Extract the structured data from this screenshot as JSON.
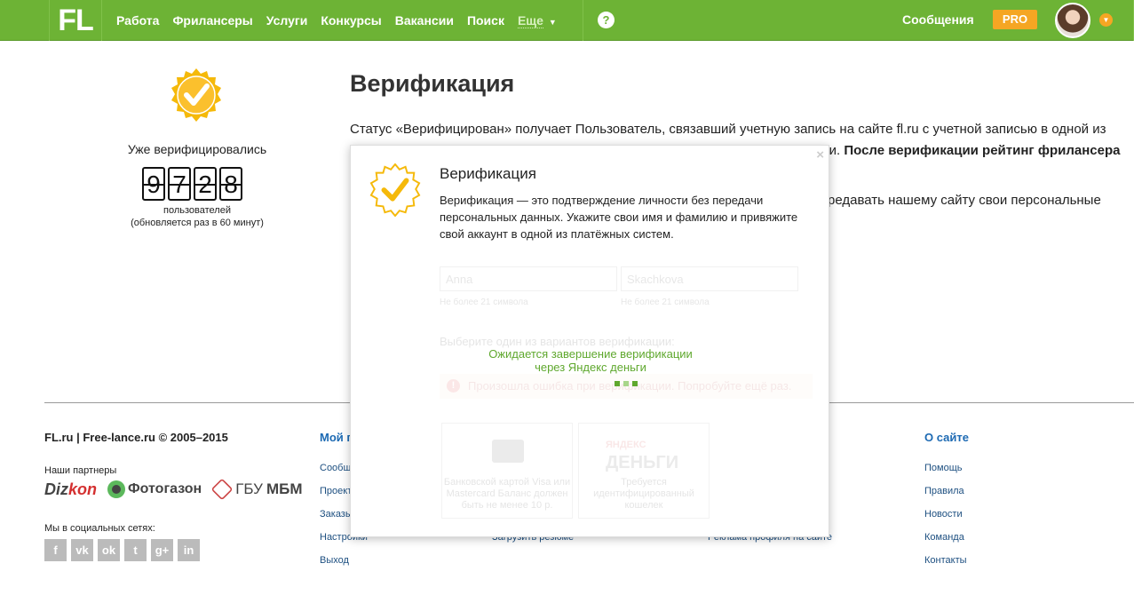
{
  "header": {
    "logo": "FL",
    "nav": [
      "Работа",
      "Фрилансеры",
      "Услуги",
      "Конкурсы",
      "Вакансии",
      "Поиск"
    ],
    "more": "Еще",
    "help": "?",
    "messages": "Сообщения",
    "pro": "PRO"
  },
  "left": {
    "already": "Уже верифицировались",
    "digits": [
      "9",
      "7",
      "2",
      "8"
    ],
    "users": "пользователей",
    "updated": "(обновляется раз в 60 минут)"
  },
  "main": {
    "title": "Верификация",
    "para1_start": "Статус «Верифицирован» получает Пользователь, связавший учетную запись на сайте fl.ru с учетной записью в одной из платежных систем, где хранится подтвержденная информация о его личности. ",
    "para1_bold": "После верификации рейтинг фрилансера",
    "para2": "редавать нашему сайту свои персональные"
  },
  "modal": {
    "close": "×",
    "title": "Верификация",
    "desc": "Верификация — это подтверждение личности без передачи персональных данных. Укажите свои имя и фамилию и привяжите свой аккаунт в одной из платёжных систем.",
    "first_name": "Anna",
    "last_name": "Skachkova",
    "hint": "Не более 21 символа",
    "choose": "Выберите один из вариантов верификации:",
    "error": "Произошла ошибка при верификации. Попробуйте ещё раз.",
    "card_text": "Банковской картой Visa или Mastercard Баланс должен быть не менее 10 р.",
    "yd_logo_small": "ЯНДЕКС",
    "yd_logo": "ДЕНЬГИ",
    "yd_text": "Требуется идентифицированный кошелек",
    "waiting_1": "Ожидается завершение верификации",
    "waiting_2": "через Яндекс деньги"
  },
  "footer": {
    "copyright": "FL.ru | Free-lance.ru © 2005–2015",
    "partners_title": "Наши партнеры",
    "partners": {
      "dizkon_a": "Diz",
      "dizkon_b": "kon",
      "fotogazon": "Фотогазон",
      "gbu_a": "ГБУ",
      "gbu_b": "МБМ"
    },
    "social_title": "Мы в социальных сетях:",
    "socials": [
      "f",
      "vk",
      "ok",
      "t",
      "g+",
      "in"
    ],
    "col1_title": "Мой п",
    "col1": [
      "Сообщ",
      "Проект",
      "Заказы",
      "Настройки",
      "Выход"
    ],
    "col2_link": "Загрузить резюме",
    "col3_link": "Реклама профиля на сайте",
    "col4_title": "О сайте",
    "col4": [
      "Помощь",
      "Правила",
      "Новости",
      "Команда",
      "Контакты"
    ]
  },
  "colors": {
    "brand_green": "#6db335",
    "pro_orange": "#f5a623",
    "link_blue": "#1d6ab3",
    "waiting_green": "#5fa82e"
  }
}
